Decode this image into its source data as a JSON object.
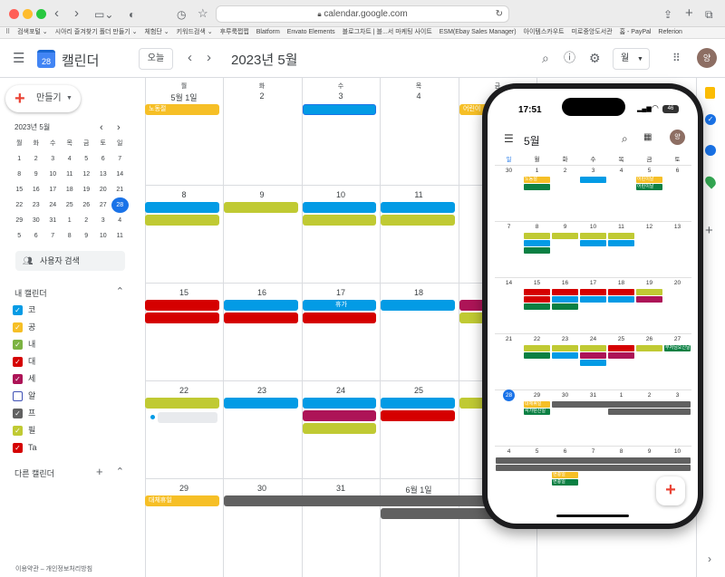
{
  "browser": {
    "url": "calendar.google.com",
    "bookmarks": [
      "검색포털 ⌄",
      "시아리 즐겨찾기 폴더 만들기 ⌄",
      "체험단 ⌄",
      "키워드검색 ⌄",
      "후루룩쩝쩝",
      "Blatform",
      "Envato Elements",
      "블로그차트 | 블...서 마케팅 사이트",
      "ESM(Ebay Sales Manager)",
      "아이템스카우트",
      "미로중앙도서관",
      "홈 - PayPal",
      "Referion"
    ]
  },
  "header": {
    "app_title": "캘린더",
    "logo_day": "28",
    "today_label": "오늘",
    "current_range": "2023년 5월",
    "view_label": "월",
    "avatar_letter": "양"
  },
  "sidebar": {
    "create_label": "만들기",
    "mini_title": "2023년 5월",
    "weekdays": [
      "월",
      "화",
      "수",
      "목",
      "금",
      "토",
      "일"
    ],
    "weeks": [
      [
        "1",
        "2",
        "3",
        "4",
        "5",
        "6",
        "7"
      ],
      [
        "8",
        "9",
        "10",
        "11",
        "12",
        "13",
        "14"
      ],
      [
        "15",
        "16",
        "17",
        "18",
        "19",
        "20",
        "21"
      ],
      [
        "22",
        "23",
        "24",
        "25",
        "26",
        "27",
        "28"
      ],
      [
        "29",
        "30",
        "31",
        "1",
        "2",
        "3",
        "4"
      ],
      [
        "5",
        "6",
        "7",
        "8",
        "9",
        "10",
        "11"
      ]
    ],
    "search_people_label": "사용자 검색",
    "my_calendars_label": "내 캘린더",
    "calendars": [
      {
        "name": "코",
        "color": "#039be5"
      },
      {
        "name": "공",
        "color": "#f6bf26"
      },
      {
        "name": "내",
        "color": "#7cb342"
      },
      {
        "name": "대",
        "color": "#d50000"
      },
      {
        "name": "세",
        "color": "#ad1457"
      },
      {
        "name": "알",
        "color": "#3f51b5"
      },
      {
        "name": "프",
        "color": "#616161"
      },
      {
        "name": "필",
        "color": "#c0ca33"
      },
      {
        "name": "Ta",
        "color": "#d50000"
      }
    ],
    "other_calendars_label": "다른 캘린더",
    "footer": "이용약관 – 개인정보처리방침"
  },
  "grid": {
    "weekdays": [
      "월",
      "화",
      "수",
      "목",
      "금"
    ],
    "week_dates": [
      [
        "5월 1일",
        "2",
        "3",
        "4"
      ],
      [
        "8",
        "9",
        "10",
        "11"
      ],
      [
        "15",
        "16",
        "17",
        "18"
      ],
      [
        "22",
        "23",
        "24",
        "25"
      ],
      [
        "29",
        "30",
        "31",
        "6월 1일"
      ]
    ],
    "event_labels": {
      "labor_day": "노동절",
      "children_day": "어린이",
      "vacation": "휴가",
      "substitute_holiday": "대체휴일"
    }
  },
  "phone": {
    "time": "17:51",
    "battery": "46",
    "month_title": "5월",
    "weekdays": [
      "일",
      "월",
      "화",
      "수",
      "목",
      "금",
      "토"
    ],
    "weeks": [
      [
        "30",
        "1",
        "2",
        "3",
        "4",
        "5",
        "6"
      ],
      [
        "7",
        "8",
        "9",
        "10",
        "11",
        "12",
        "13"
      ],
      [
        "14",
        "15",
        "16",
        "17",
        "18",
        "19",
        "20"
      ],
      [
        "21",
        "22",
        "23",
        "24",
        "25",
        "26",
        "27"
      ],
      [
        "28",
        "29",
        "30",
        "31",
        "1",
        "2",
        "3"
      ],
      [
        "4",
        "5",
        "6",
        "7",
        "8",
        "9",
        "10"
      ]
    ],
    "labels": {
      "labor": "노동절",
      "children1": "어린이날",
      "children2": "어린이날",
      "buddha": "부처님오신날",
      "sub_holiday": "대체휴일",
      "sub_holiday2": "석가탄신일",
      "hyun1": "현충일",
      "hyun2": "현충일"
    }
  },
  "colors": {
    "accent": "#1a73e8",
    "yellow": "#f6bf26",
    "blue": "#039be5",
    "lime": "#c0ca33",
    "red": "#d50000",
    "gray": "#616161",
    "teal": "#0b8043",
    "magenta": "#ad1457"
  }
}
